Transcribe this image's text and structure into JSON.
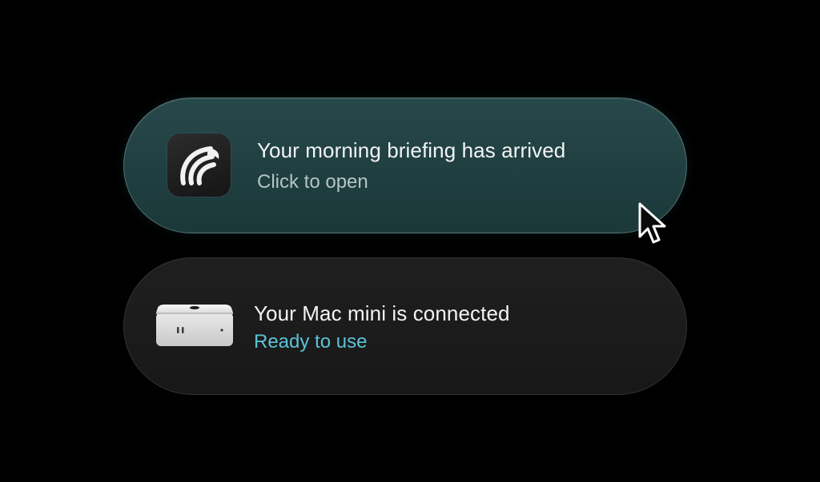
{
  "notifications": [
    {
      "title": "Your morning briefing has arrived",
      "subtitle": "Click to open",
      "icon": "briefing-app-icon",
      "accent": "#27484a"
    },
    {
      "title": "Your Mac mini is connected",
      "subtitle": "Ready to use",
      "icon": "mac-mini-icon",
      "subtitle_color": "#5cc3d6"
    }
  ],
  "cursor": {
    "icon": "pointer-cursor-icon"
  }
}
